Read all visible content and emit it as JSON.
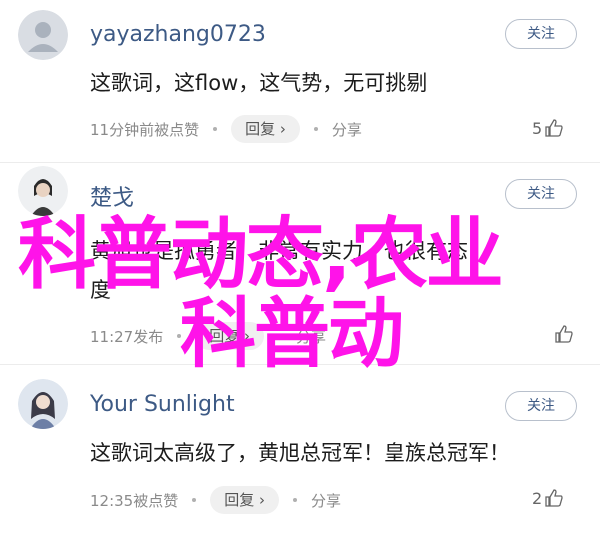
{
  "comments": [
    {
      "username": "yayazhang0723",
      "follow": "关注",
      "text": "这歌词，这flow，这气势，无可挑剔",
      "time": "11分钟前被点赞",
      "reply": "回复 ›",
      "share": "分享",
      "likes": "5"
    },
    {
      "username": "楚戈",
      "follow": "关注",
      "text_line1": "黄旭也是孤勇者，非常有实力，也很有态",
      "text_line2": "度",
      "time": "11:27发布",
      "reply": "回复 ›",
      "share": "分享",
      "likes": ""
    },
    {
      "username": "Your Sunlight",
      "follow": "关注",
      "text": "这歌词太高级了，黄旭总冠军！皇族总冠军！",
      "time": "12:35被点赞",
      "reply": "回复 ›",
      "share": "分享",
      "likes": "2"
    }
  ],
  "watermark": {
    "line1": "科普动态,农业",
    "line2": "科普动",
    "color": "#ff13e9"
  },
  "icons": {
    "avatar_default": "person-silhouette-icon",
    "like": "thumbs-up-icon"
  }
}
